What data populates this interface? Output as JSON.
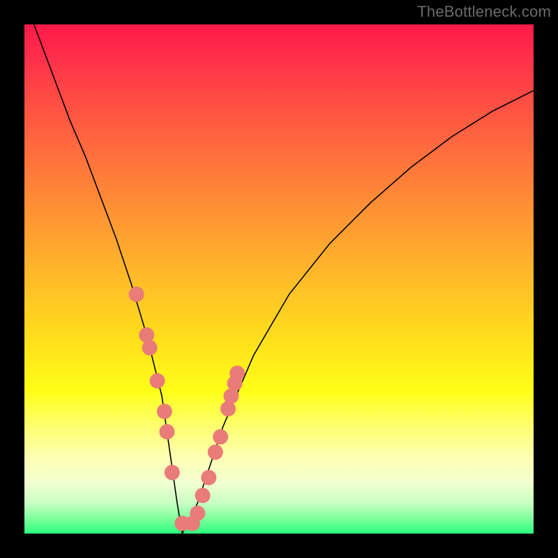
{
  "watermark": "TheBottleneck.com",
  "chart_data": {
    "type": "line",
    "title": "",
    "xlabel": "",
    "ylabel": "",
    "xlim": [
      0,
      100
    ],
    "ylim": [
      0,
      100
    ],
    "min_x": 31,
    "series": [
      {
        "name": "bottleneck-curve",
        "x": [
          0,
          3,
          6,
          9,
          12,
          15,
          18,
          21,
          24,
          27,
          30,
          31,
          34,
          39,
          45,
          52,
          60,
          68,
          76,
          84,
          92,
          100
        ],
        "values": [
          105,
          97,
          89,
          81,
          74,
          66,
          58,
          49,
          39,
          27,
          6,
          0,
          6,
          21,
          35,
          47,
          57,
          65,
          72,
          78,
          83,
          87
        ]
      }
    ],
    "highlight_points": {
      "name": "near-min-dots",
      "x": [
        22,
        24,
        24.6,
        26.1,
        27.5,
        28,
        29,
        31,
        33,
        34,
        35,
        36.2,
        37.5,
        38.5,
        40.0,
        40.6,
        41.3,
        41.8
      ],
      "values": [
        47,
        39,
        36.5,
        30,
        24,
        20,
        12,
        2,
        2,
        4,
        7.5,
        11,
        16,
        19.0,
        24.5,
        27.0,
        29.5,
        31.5
      ]
    },
    "curve_style": {
      "stroke": "#000000",
      "width": 1.6
    },
    "dot_style": {
      "fill": "#e97b78",
      "radius": 11
    }
  }
}
